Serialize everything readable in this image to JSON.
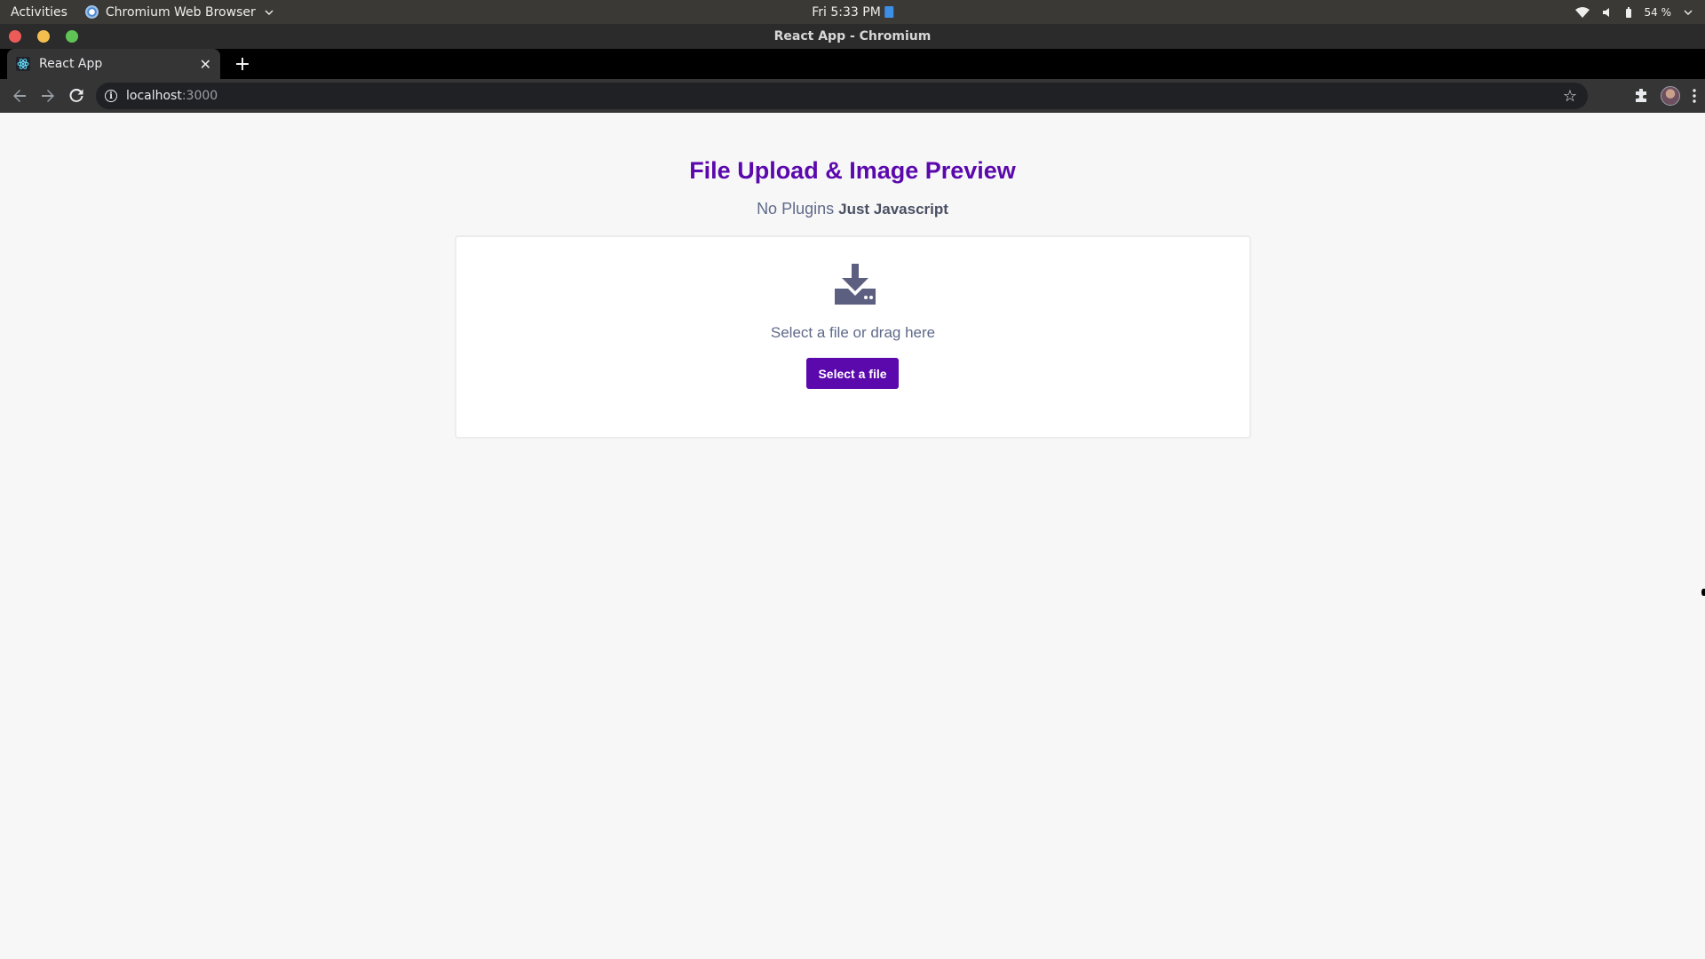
{
  "system_bar": {
    "activities": "Activities",
    "app_name": "Chromium Web Browser",
    "clock": "Fri  5:33 PM",
    "battery": "54 %"
  },
  "window": {
    "title": "React App - Chromium"
  },
  "tabs": [
    {
      "label": "React App",
      "icon": "react-icon",
      "active": true
    }
  ],
  "address_bar": {
    "host": "localhost",
    "port": ":3000"
  },
  "page": {
    "title": "File Upload & Image Preview",
    "subtitle_plain": "No Plugins",
    "subtitle_bold": "Just Javascript",
    "dropzone_text": "Select a file or drag here",
    "button_label": "Select a file",
    "accent_color": "#5b08ad",
    "icon": "download-tray-icon"
  }
}
